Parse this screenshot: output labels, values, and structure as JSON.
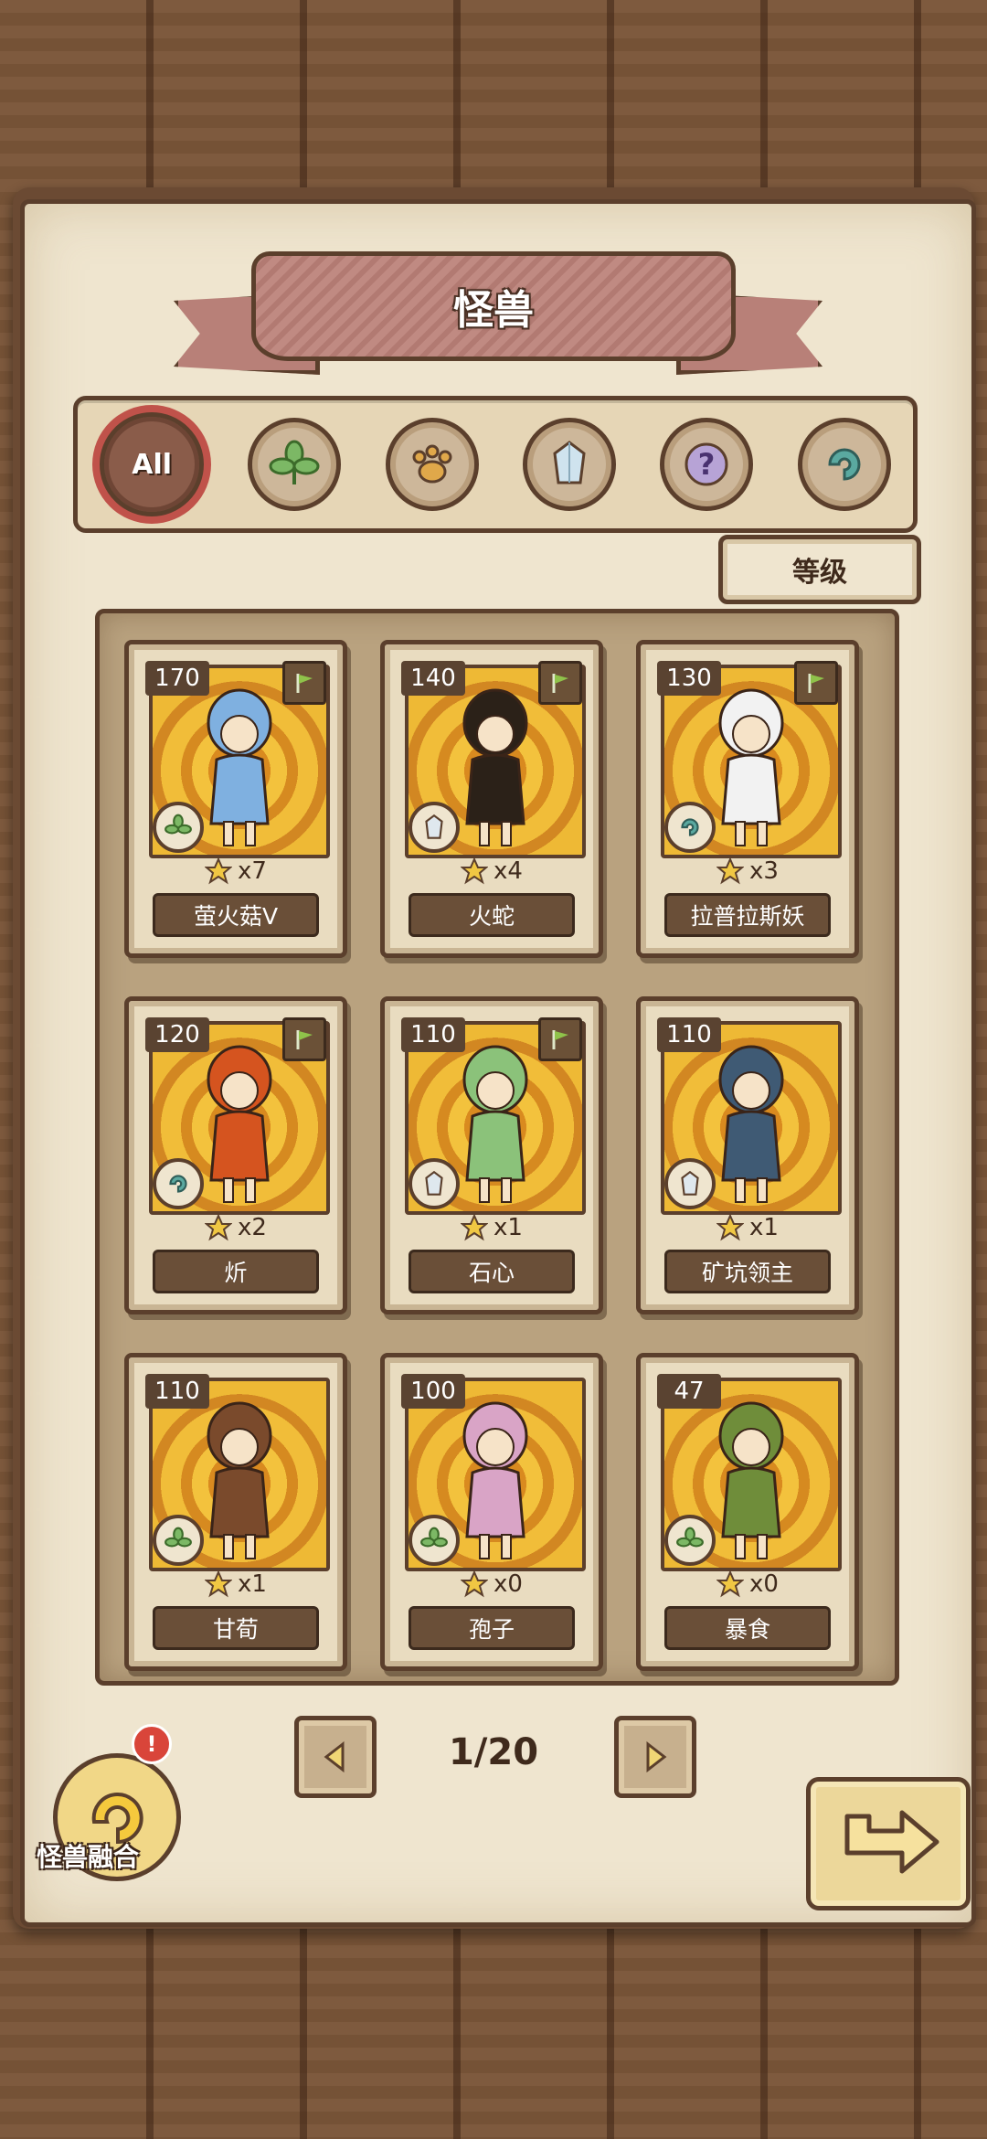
{
  "header": {
    "title": "怪兽"
  },
  "filters": [
    {
      "label": "All",
      "icon": "all-icon",
      "active": true
    },
    {
      "icon": "leaf-icon",
      "active": false
    },
    {
      "icon": "paw-icon",
      "active": false
    },
    {
      "icon": "crystal-icon",
      "active": false
    },
    {
      "icon": "question-icon",
      "active": false
    },
    {
      "icon": "spiral-icon",
      "active": false
    }
  ],
  "sort": {
    "label": "等级"
  },
  "cards": [
    {
      "level": "170",
      "stars": "x7",
      "name": "萤火菇Ⅴ",
      "element": "leaf",
      "flag": true,
      "color": "#7fb0e0"
    },
    {
      "level": "140",
      "stars": "x4",
      "name": "火蛇",
      "element": "crystal",
      "flag": true,
      "color": "#2b2118"
    },
    {
      "level": "130",
      "stars": "x3",
      "name": "拉普拉斯妖",
      "element": "spiral",
      "flag": true,
      "color": "#f2f2f2"
    },
    {
      "level": "120",
      "stars": "x2",
      "name": "炘",
      "element": "spiral",
      "flag": true,
      "color": "#d5541f"
    },
    {
      "level": "110",
      "stars": "x1",
      "name": "石心",
      "element": "crystal",
      "flag": true,
      "color": "#8bc27a"
    },
    {
      "level": "110",
      "stars": "x1",
      "name": "矿坑领主",
      "element": "crystal",
      "flag": false,
      "color": "#3f5a74"
    },
    {
      "level": "110",
      "stars": "x1",
      "name": "甘荀",
      "element": "leaf",
      "flag": false,
      "color": "#7a4a2c"
    },
    {
      "level": "100",
      "stars": "x0",
      "name": "孢子",
      "element": "leaf",
      "flag": false,
      "color": "#d9a4c6"
    },
    {
      "level": "47",
      "stars": "x0",
      "name": "暴食",
      "element": "leaf",
      "flag": false,
      "color": "#6f8d3a"
    }
  ],
  "pager": {
    "label": "1/20"
  },
  "fusion": {
    "label": "怪兽融合",
    "alert": "!"
  },
  "colors": {
    "accent": "#c0524a",
    "ink": "#5b3f2c",
    "paper": "#efe5cf"
  }
}
